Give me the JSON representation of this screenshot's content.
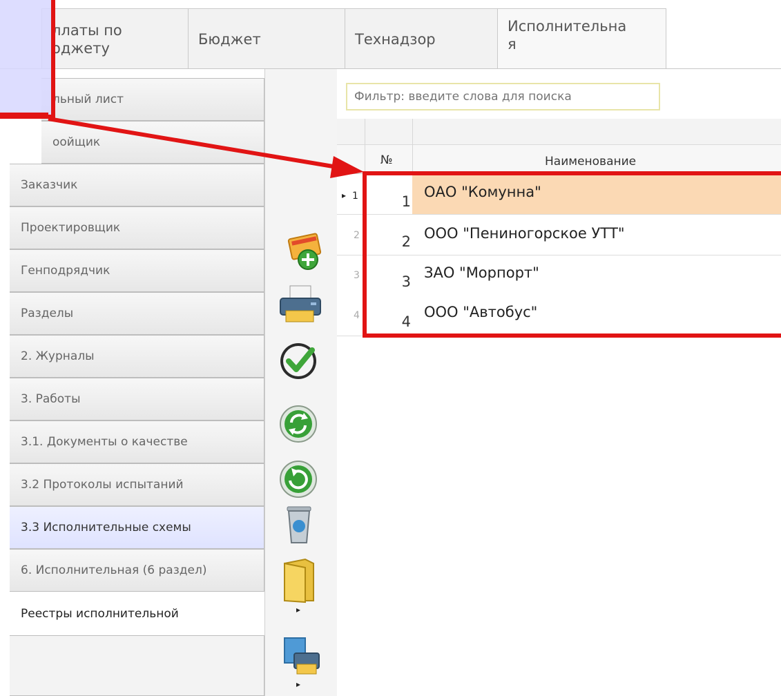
{
  "top_tabs": [
    {
      "label": "ллаты по\nоджету"
    },
    {
      "label": "Бюджет"
    },
    {
      "label": "Технадзор"
    },
    {
      "label": "Исполнительна\nя"
    }
  ],
  "nav": {
    "items": [
      {
        "label": "льный лист"
      },
      {
        "label": "оойщик"
      },
      {
        "label": "Заказчик"
      },
      {
        "label": "Проектировщик"
      },
      {
        "label": "Генподрядчик"
      },
      {
        "label": "Разделы"
      },
      {
        "label": "2. Журналы"
      },
      {
        "label": "3. Работы"
      },
      {
        "label": "3.1. Документы о качестве"
      },
      {
        "label": "3.2 Протоколы испытаний"
      },
      {
        "label": "3.3 Исполнительные схемы"
      },
      {
        "label": "6. Исполнительная (6 раздел)"
      },
      {
        "label": "Реестры исполнительной"
      }
    ]
  },
  "toolbar": {
    "icons": [
      "add-properties-icon",
      "printer-icon",
      "checkmark-icon",
      "refresh-icon",
      "reload-icon",
      "recycle-bin-icon",
      "folder-icon",
      "print-to-file-icon"
    ]
  },
  "filter": {
    "placeholder": "Фильтр: введите слова для поиска"
  },
  "grid": {
    "columns": {
      "no": "№",
      "name": "Наименование"
    },
    "rows": [
      {
        "index": "1",
        "no": "1",
        "name": "ОАО \"Комунна\""
      },
      {
        "index": "2",
        "no": "2",
        "name": "ООО \"Пениногорское УТТ\""
      },
      {
        "index": "3",
        "no": "3",
        "name": "ЗАО \"Морпорт\""
      },
      {
        "index": "4",
        "no": "4",
        "name": "ООО \"Автобус\""
      }
    ]
  },
  "colors": {
    "annotation_red": "#e11414",
    "selected_row": "#fbd9b4",
    "selected_nav": "#dfe3ff"
  }
}
